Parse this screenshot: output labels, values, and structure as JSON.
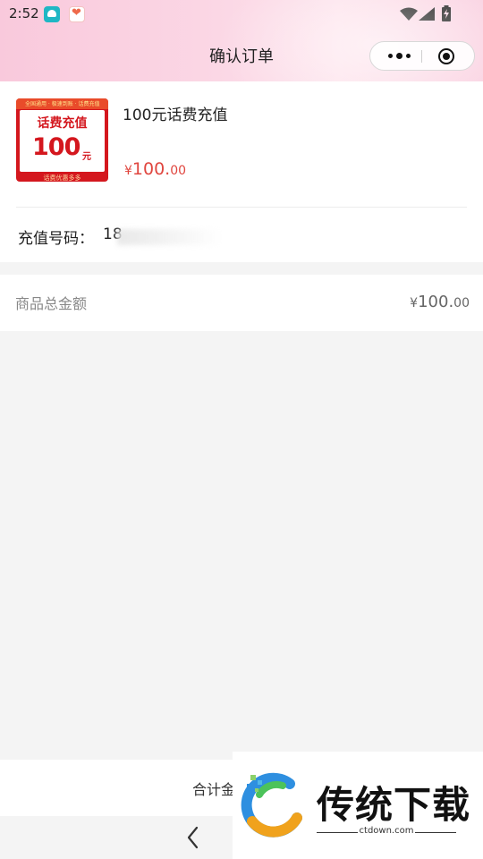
{
  "status_bar": {
    "time": "2:52"
  },
  "nav": {
    "title": "确认订单"
  },
  "product": {
    "image": {
      "top_text": "全国通用 · 极速到账 · 话费充值",
      "title": "话费充值",
      "amount": "100",
      "unit": "元",
      "bottom_text": "话费优惠多多"
    },
    "name": "100元话费充值",
    "price": {
      "currency": "¥",
      "integer": "100.",
      "decimal": "00"
    },
    "phone_label": "充值号码：",
    "phone_value": "18"
  },
  "summary": {
    "label": "商品总金额",
    "price": {
      "currency": "¥",
      "integer": "100.",
      "decimal": "00"
    }
  },
  "bottom_bar": {
    "total_label": "合计金"
  },
  "watermark": {
    "brand": "传统下载",
    "url": "ctdown.com"
  },
  "colors": {
    "price_red": "#e0463f",
    "header_pink": "#fbd7e5",
    "product_red": "#d4171e"
  }
}
